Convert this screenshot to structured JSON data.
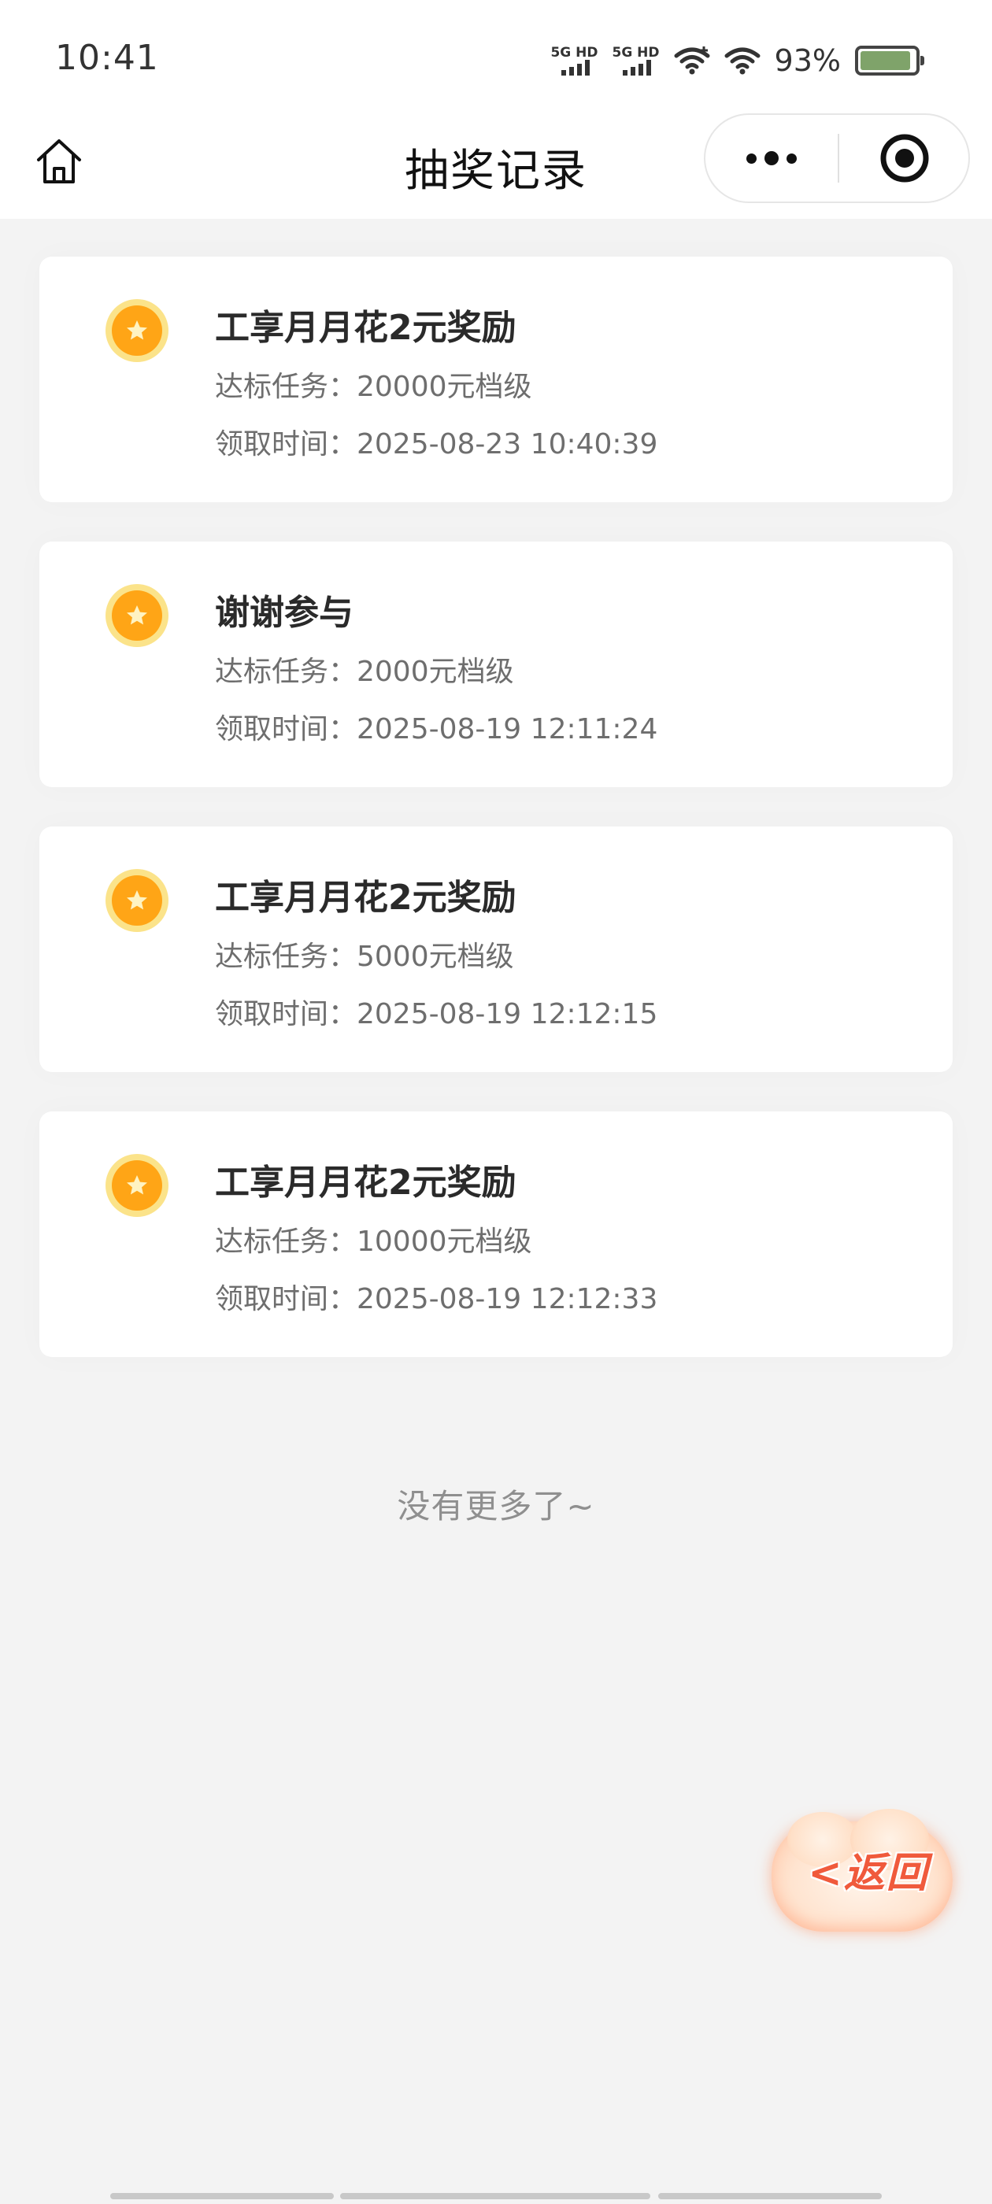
{
  "status_bar": {
    "time": "10:41",
    "signal_1_label": "5G HD",
    "signal_2_label": "5G HD",
    "battery_percent": "93%",
    "battery_level": 0.93,
    "battery_color": "#7fa36a"
  },
  "nav": {
    "title": "抽奖记录",
    "home_icon": "home-icon",
    "more_icon": "more-dots-icon",
    "close_icon": "target-circle-icon"
  },
  "records": [
    {
      "title": "工享月月花2元奖励",
      "task": "达标任务：20000元档级",
      "time": "领取时间：2025-08-23 10:40:39"
    },
    {
      "title": "谢谢参与",
      "task": "达标任务：2000元档级",
      "time": "领取时间：2025-08-19 12:11:24"
    },
    {
      "title": "工享月月花2元奖励",
      "task": "达标任务：5000元档级",
      "time": "领取时间：2025-08-19 12:12:15"
    },
    {
      "title": "工享月月花2元奖励",
      "task": "达标任务：10000元档级",
      "time": "领取时间：2025-08-19 12:12:33"
    }
  ],
  "footer": {
    "no_more": "没有更多了~"
  },
  "back_button": {
    "label": "<返回",
    "color": "#f05a3c"
  },
  "colors": {
    "coin": "#ffa516",
    "coin_ring": "#fbe38a",
    "background": "#f3f3f3"
  }
}
